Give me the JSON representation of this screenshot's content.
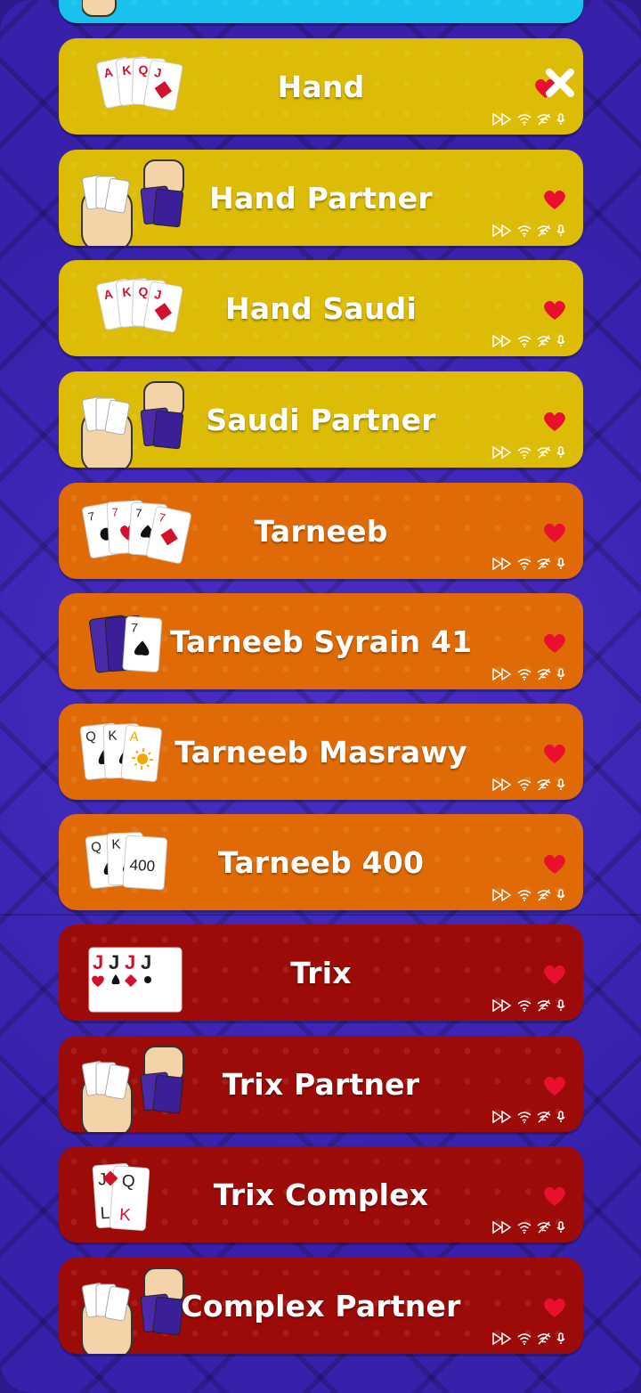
{
  "games": [
    {
      "name": "",
      "color": "cyan",
      "fav_icon": "none"
    },
    {
      "name": "Hand",
      "color": "yellow",
      "fav_icon": "close-icon"
    },
    {
      "name": "Hand Partner",
      "color": "yellow",
      "fav_icon": "heart-icon"
    },
    {
      "name": "Hand Saudi",
      "color": "yellow",
      "fav_icon": "heart-icon"
    },
    {
      "name": "Saudi Partner",
      "color": "yellow",
      "fav_icon": "heart-icon"
    },
    {
      "name": "Tarneeb",
      "color": "orange",
      "fav_icon": "heart-icon"
    },
    {
      "name": "Tarneeb Syrain 41",
      "color": "orange",
      "fav_icon": "heart-icon"
    },
    {
      "name": "Tarneeb Masrawy",
      "color": "orange",
      "fav_icon": "heart-icon"
    },
    {
      "name": "Tarneeb 400",
      "color": "orange",
      "fav_icon": "heart-icon"
    },
    {
      "name": "Trix",
      "color": "red",
      "fav_icon": "heart-icon"
    },
    {
      "name": "Trix Partner",
      "color": "red",
      "fav_icon": "heart-icon"
    },
    {
      "name": "Trix Complex",
      "color": "red",
      "fav_icon": "heart-icon"
    },
    {
      "name": "Complex Partner",
      "color": "red",
      "fav_icon": "heart-icon"
    }
  ],
  "card_text": {
    "hand": [
      "A",
      "K",
      "Q",
      "J"
    ],
    "tarneeb": [
      "7",
      "7",
      "7",
      "7"
    ],
    "syrian": [
      "7"
    ],
    "masrawy": [
      "Q",
      "K",
      "A"
    ],
    "t400": [
      "Q",
      "K",
      "400"
    ],
    "trix": [
      "J",
      "J",
      "J",
      "J"
    ],
    "complex": [
      "J",
      "Q",
      "L",
      "K"
    ]
  },
  "feature_icons": [
    "fast-forward-icon",
    "wifi-icon",
    "no-wifi-icon",
    "microphone-icon"
  ],
  "colors": {
    "background": "#3b22b4",
    "yellow": "#dcbc06",
    "orange": "#e06b06",
    "red": "#9c0b08",
    "cyan": "#18c2ec",
    "heart": "#e8102c"
  }
}
